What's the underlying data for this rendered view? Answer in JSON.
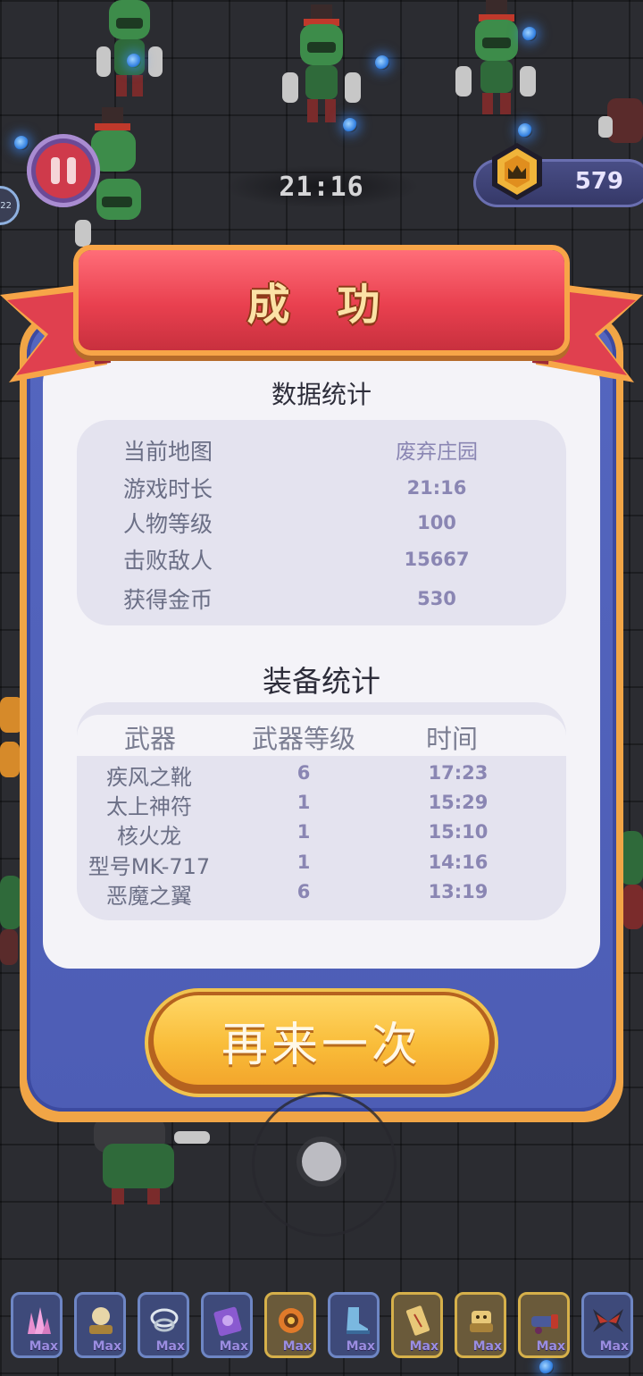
{
  "hud": {
    "timer": "21:16",
    "coins": "579",
    "side_badge": "22"
  },
  "dialog": {
    "title": "成 功",
    "stats_title": "数据统计",
    "stats": [
      {
        "label": "当前地图",
        "value": "废弃庄园"
      },
      {
        "label": "游戏时长",
        "value": "21:16"
      },
      {
        "label": "人物等级",
        "value": "100"
      },
      {
        "label": "击败敌人",
        "value": "15667"
      },
      {
        "label": "获得金币",
        "value": "530"
      }
    ],
    "equip_title": "装备统计",
    "equip_headers": {
      "weapon": "武器",
      "level": "武器等级",
      "time": "时间"
    },
    "equipment": [
      {
        "name": "疾风之靴",
        "level": "6",
        "time": "17:23"
      },
      {
        "name": "太上神符",
        "level": "1",
        "time": "15:29"
      },
      {
        "name": "核火龙",
        "level": "1",
        "time": "15:10"
      },
      {
        "name": "型号MK-717",
        "level": "1",
        "time": "14:16"
      },
      {
        "name": "恶魔之翼",
        "level": "6",
        "time": "13:19"
      }
    ],
    "again_button": "再来一次"
  },
  "skills": [
    {
      "icon": "crystal-icon",
      "max": "Max",
      "frame": "blue"
    },
    {
      "icon": "orb-stand-icon",
      "max": "Max",
      "frame": "blue"
    },
    {
      "icon": "chain-icon",
      "max": "Max",
      "frame": "blue"
    },
    {
      "icon": "purple-scroll-icon",
      "max": "Max",
      "frame": "blue"
    },
    {
      "icon": "fire-ring-icon",
      "max": "Max",
      "frame": "gold"
    },
    {
      "icon": "boot-icon",
      "max": "Max",
      "frame": "blue"
    },
    {
      "icon": "talisman-icon",
      "max": "Max",
      "frame": "gold"
    },
    {
      "icon": "golem-icon",
      "max": "Max",
      "frame": "gold"
    },
    {
      "icon": "rocket-launcher-icon",
      "max": "Max",
      "frame": "gold"
    },
    {
      "icon": "demon-wings-icon",
      "max": "Max",
      "frame": "blue"
    }
  ],
  "colors": {
    "ribbon": "#e9404f",
    "panel_blue": "#5466bf",
    "button_gold": "#f9bd3a",
    "stat_value": "#8a86b3"
  }
}
